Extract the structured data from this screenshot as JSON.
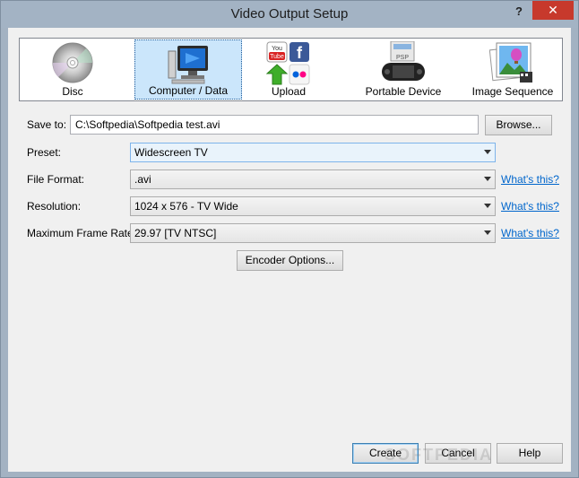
{
  "window": {
    "title": "Video Output Setup",
    "help_glyph": "?",
    "close_glyph": "✕"
  },
  "toolbar": {
    "items": [
      {
        "label": "Disc",
        "selected": false
      },
      {
        "label": "Computer / Data",
        "selected": true
      },
      {
        "label": "Upload",
        "selected": false
      },
      {
        "label": "Portable Device",
        "selected": false
      },
      {
        "label": "Image Sequence",
        "selected": false
      }
    ],
    "youtube_top": "You",
    "youtube_bottom": "Tube",
    "facebook_glyph": "f",
    "psp_text": "PSP"
  },
  "form": {
    "save_to_label": "Save to:",
    "save_to_value": "C:\\Softpedia\\Softpedia test.avi",
    "browse_label": "Browse...",
    "preset_label": "Preset:",
    "preset_value": "Widescreen TV",
    "file_format_label": "File Format:",
    "file_format_value": ".avi",
    "resolution_label": "Resolution:",
    "resolution_value": "1024 x 576 - TV Wide",
    "frame_rate_label": "Maximum Frame Rate:",
    "frame_rate_value": "29.97 [TV NTSC]",
    "whats_this": "What's this?",
    "encoder_options_label": "Encoder Options..."
  },
  "footer": {
    "create_label": "Create",
    "cancel_label": "Cancel",
    "help_label": "Help"
  },
  "watermark": "SOFTPEDIA"
}
